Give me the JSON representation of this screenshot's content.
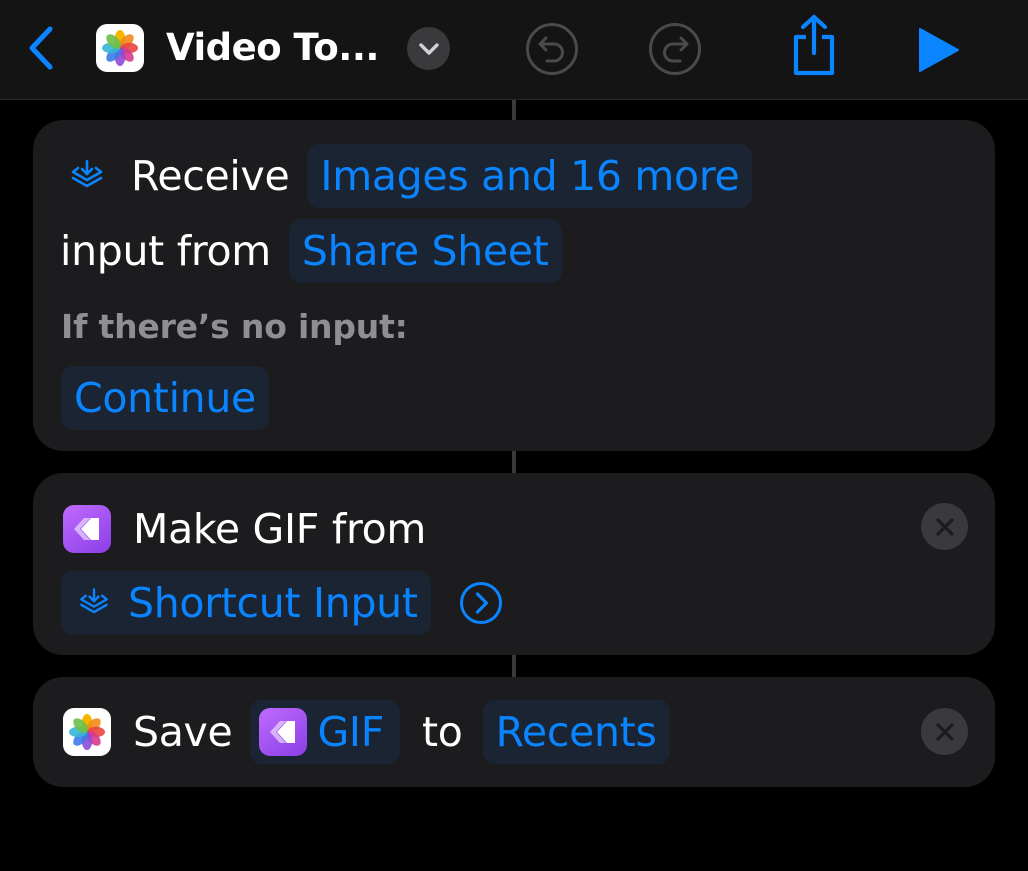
{
  "navbar": {
    "title": "Video To...",
    "icons": {
      "back": "chevron-left-icon",
      "app": "photos-icon",
      "menu": "chevron-down-icon",
      "undo": "undo-icon",
      "redo": "redo-icon",
      "share": "share-icon",
      "run": "play-icon"
    }
  },
  "actions": [
    {
      "verb": "Receive",
      "input_types": "Images and 16 more",
      "middle_text": "input from",
      "source": "Share Sheet",
      "fallback_label": "If there’s no input:",
      "fallback_value": "Continue",
      "icon": "shortcut-input-icon"
    },
    {
      "title": "Make GIF from",
      "input": "Shortcut Input",
      "icon": "make-gif-icon",
      "input_icon": "shortcut-input-icon",
      "detail_icon": "chevron-right-circle-icon",
      "remove_icon": "remove-icon"
    },
    {
      "verb": "Save",
      "variable": "GIF",
      "middle_text": "to",
      "destination": "Recents",
      "icon": "photos-icon",
      "variable_icon": "make-gif-icon",
      "remove_icon": "remove-icon"
    }
  ],
  "colors": {
    "background": "#000000",
    "card": "#1c1c1e",
    "accent": "#0a84ff",
    "token_bg": "#1a2433",
    "secondary_text": "#8e8e93",
    "gif_purple": "#a855f7"
  }
}
